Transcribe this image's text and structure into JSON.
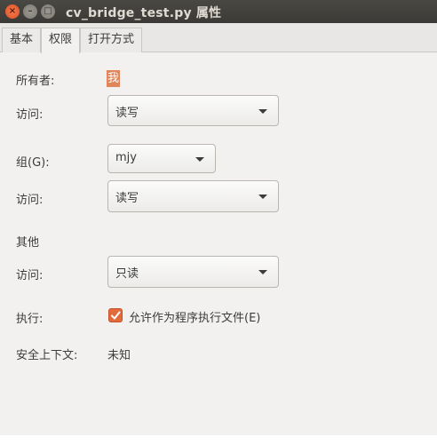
{
  "window": {
    "title": "cv_bridge_test.py 属性",
    "close_glyph": "×",
    "min_glyph": "–",
    "max_glyph": "□"
  },
  "tabs": [
    {
      "label": "基本"
    },
    {
      "label": "权限"
    },
    {
      "label": "打开方式"
    }
  ],
  "permissions": {
    "owner_label": "所有者:",
    "owner_value": "我",
    "owner_access_label": "访问:",
    "owner_access_value": "读写",
    "group_label": "组(G):",
    "group_value": "mjy",
    "group_access_label": "访问:",
    "group_access_value": "读写",
    "others_label": "其他",
    "others_access_label": "访问:",
    "others_access_value": "只读",
    "execute_label": "执行:",
    "execute_checkbox_label": "允许作为程序执行文件(E)",
    "execute_checked": true,
    "security_context_label": "安全上下文:",
    "security_context_value": "未知"
  },
  "colors": {
    "accent": "#e26b3b",
    "titlebar": "#3b3a36",
    "window_bg": "#f2f1f0"
  }
}
